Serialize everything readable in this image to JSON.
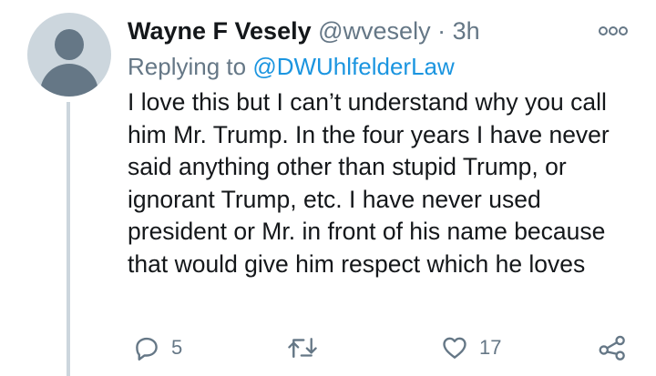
{
  "tweet": {
    "display_name": "Wayne F Vesely",
    "handle": "@wvesely",
    "separator": "·",
    "time": "3h",
    "replying_prefix": "Replying to ",
    "replying_to": "@DWUhlfelderLaw",
    "text": "I love this but I can’t understand why you call him Mr. Trump. In the four years I have never said anything other than stupid Trump, or ignorant Trump, etc. I have never used president or Mr. in front of his name because that would give him respect which he loves"
  },
  "actions": {
    "reply_count": "5",
    "retweet_count": "",
    "like_count": "17"
  },
  "icons": {
    "avatar": "default-avatar-icon",
    "more": "more-options-icon",
    "reply": "reply-icon",
    "retweet": "retweet-icon",
    "like": "heart-icon",
    "share": "share-icon"
  },
  "colors": {
    "text": "#14171a",
    "secondary": "#657786",
    "link": "#1b95e0",
    "thread_line": "#ccd6dd"
  }
}
